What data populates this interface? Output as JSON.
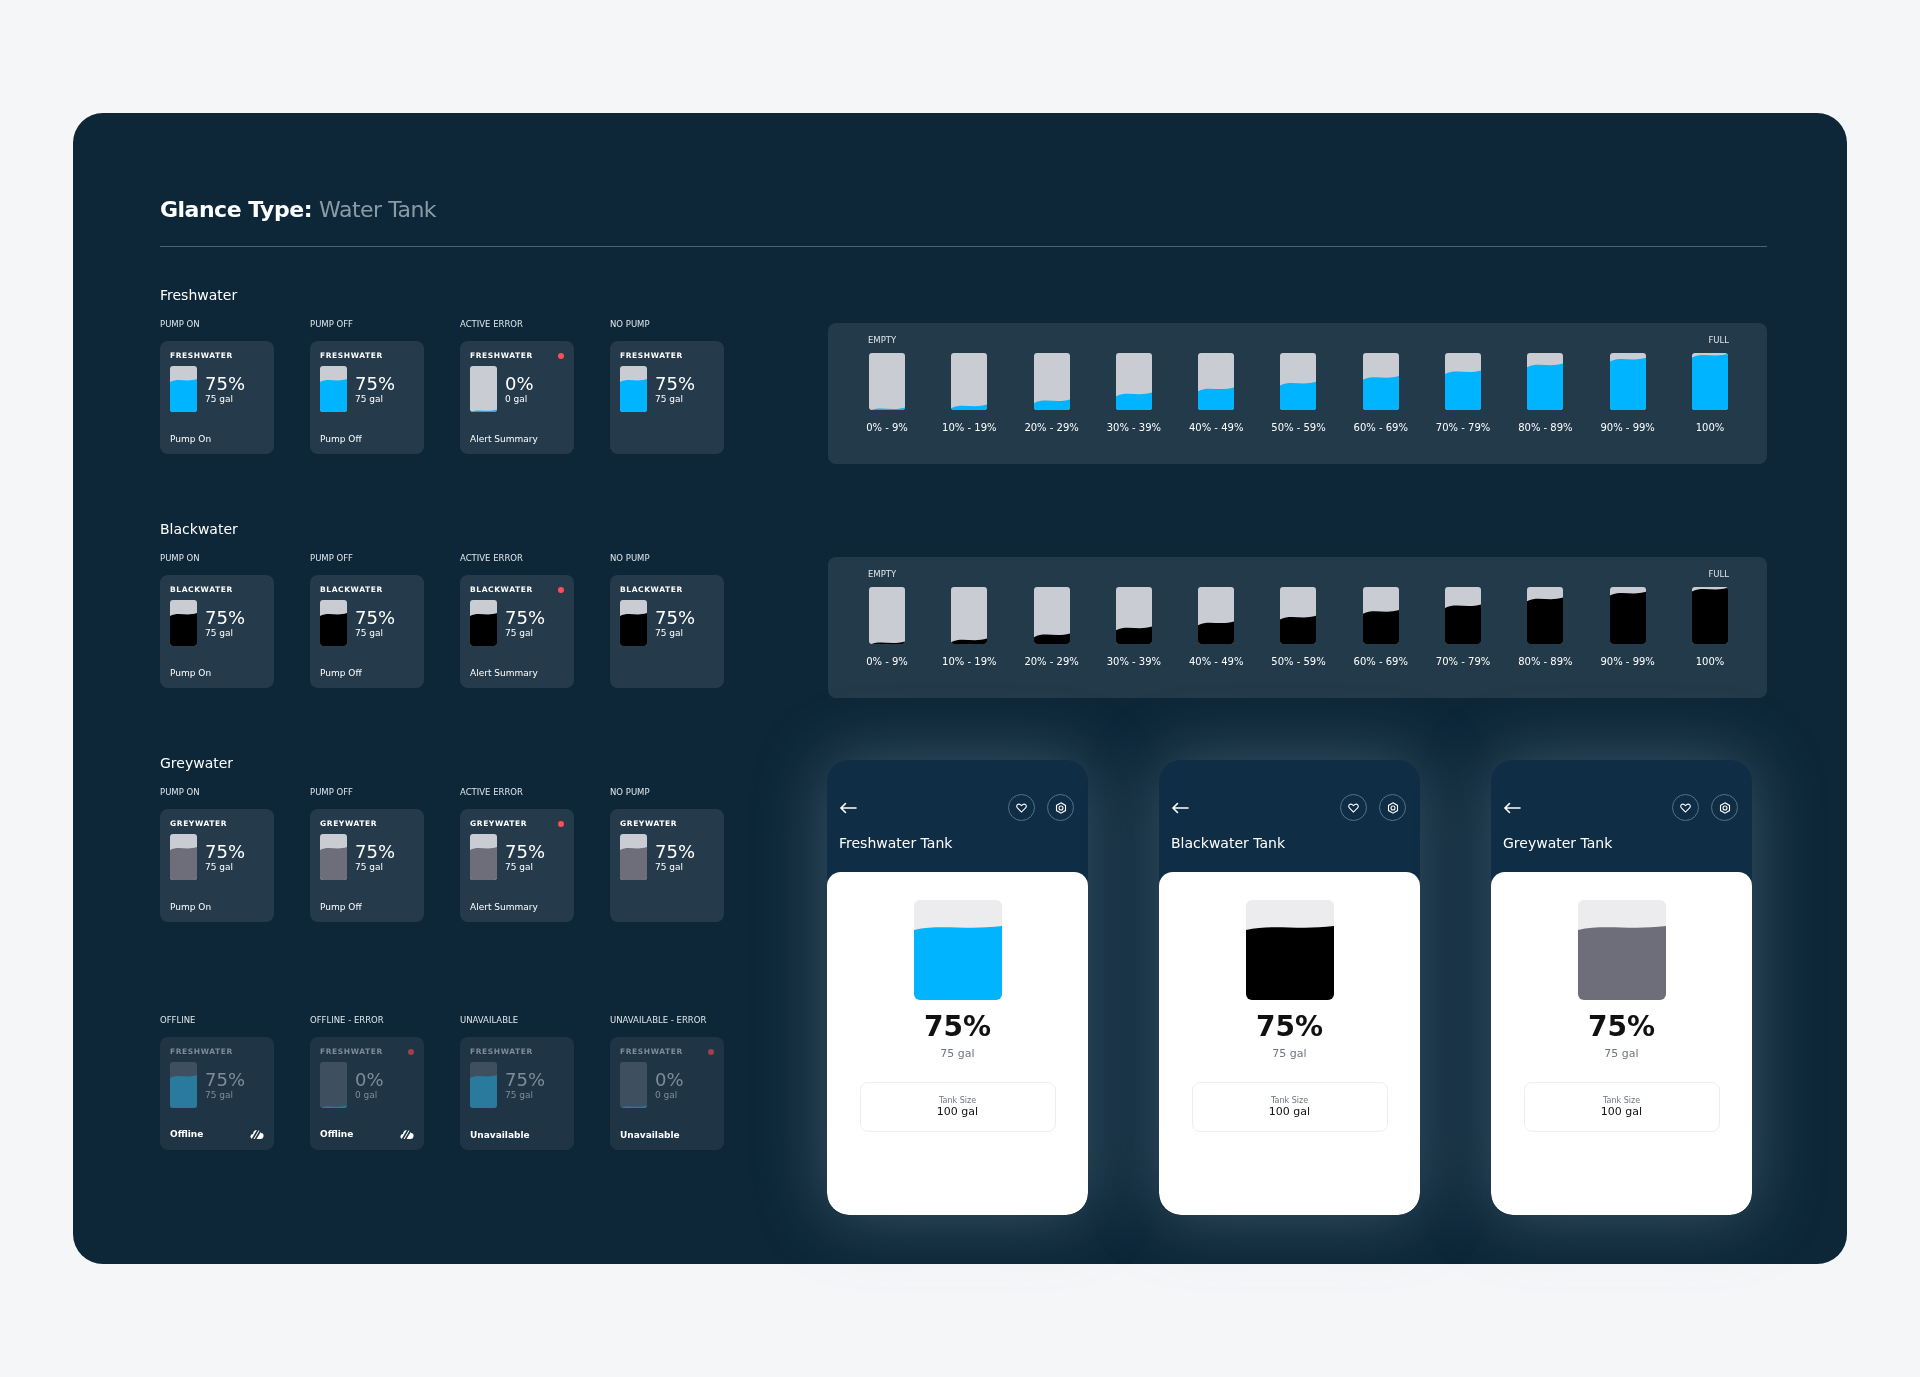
{
  "title": {
    "lead": "Glance Type:",
    "value": "Water Tank"
  },
  "sections": [
    {
      "name": "Freshwater",
      "scale": {
        "kind": "fresh",
        "empty_label": "EMPTY",
        "full_label": "FULL",
        "steps": [
          {
            "label": "0% - 9%",
            "level": 0.03
          },
          {
            "label": "10% - 19%",
            "level": 0.08
          },
          {
            "label": "20% - 29%",
            "level": 0.17
          },
          {
            "label": "30% - 39%",
            "level": 0.29
          },
          {
            "label": "40% - 49%",
            "level": 0.38
          },
          {
            "label": "50% - 59%",
            "level": 0.48
          },
          {
            "label": "60% - 69%",
            "level": 0.58
          },
          {
            "label": "70% - 79%",
            "level": 0.68
          },
          {
            "label": "80% - 89%",
            "level": 0.8
          },
          {
            "label": "90% - 99%",
            "level": 0.9
          },
          {
            "label": "100%",
            "level": 0.97
          }
        ]
      },
      "cards": [
        {
          "state": "PUMP ON",
          "tank": "FRESHWATER",
          "kind": "fresh",
          "percent": "75%",
          "gal": "75 gal",
          "level": 0.7,
          "footer": "Pump On",
          "alert": false,
          "dimmed": false
        },
        {
          "state": "PUMP OFF",
          "tank": "FRESHWATER",
          "kind": "fresh",
          "percent": "75%",
          "gal": "75 gal",
          "level": 0.7,
          "footer": "Pump Off",
          "alert": false,
          "dimmed": false
        },
        {
          "state": "ACTIVE ERROR",
          "tank": "FRESHWATER",
          "kind": "fresh",
          "percent": "0%",
          "gal": "0 gal",
          "level": 0.04,
          "footer": "Alert Summary",
          "alert": true,
          "dimmed": false
        },
        {
          "state": "NO PUMP",
          "tank": "FRESHWATER",
          "kind": "fresh",
          "percent": "75%",
          "gal": "75 gal",
          "level": 0.7,
          "alert": false,
          "dimmed": false
        }
      ]
    },
    {
      "name": "Blackwater",
      "scale": {
        "kind": "black",
        "empty_label": "EMPTY",
        "full_label": "FULL",
        "steps": [
          {
            "label": "0% - 9%",
            "level": 0.03
          },
          {
            "label": "10% - 19%",
            "level": 0.08
          },
          {
            "label": "20% - 29%",
            "level": 0.17
          },
          {
            "label": "30% - 39%",
            "level": 0.29
          },
          {
            "label": "40% - 49%",
            "level": 0.38
          },
          {
            "label": "50% - 59%",
            "level": 0.48
          },
          {
            "label": "60% - 69%",
            "level": 0.58
          },
          {
            "label": "70% - 79%",
            "level": 0.68
          },
          {
            "label": "80% - 89%",
            "level": 0.8
          },
          {
            "label": "90% - 99%",
            "level": 0.9
          },
          {
            "label": "100%",
            "level": 0.97
          }
        ]
      },
      "cards": [
        {
          "state": "PUMP ON",
          "tank": "BLACKWATER",
          "kind": "black",
          "percent": "75%",
          "gal": "75 gal",
          "level": 0.7,
          "footer": "Pump On",
          "alert": false,
          "dimmed": false
        },
        {
          "state": "PUMP OFF",
          "tank": "BLACKWATER",
          "kind": "black",
          "percent": "75%",
          "gal": "75 gal",
          "level": 0.7,
          "footer": "Pump Off",
          "alert": false,
          "dimmed": false
        },
        {
          "state": "ACTIVE ERROR",
          "tank": "BLACKWATER",
          "kind": "black",
          "percent": "75%",
          "gal": "75 gal",
          "level": 0.7,
          "footer": "Alert Summary",
          "alert": true,
          "dimmed": false
        },
        {
          "state": "NO PUMP",
          "tank": "BLACKWATER",
          "kind": "black",
          "percent": "75%",
          "gal": "75 gal",
          "level": 0.7,
          "alert": false,
          "dimmed": false
        }
      ]
    },
    {
      "name": "Greywater",
      "cards": [
        {
          "state": "PUMP ON",
          "tank": "GREYWATER",
          "kind": "grey",
          "percent": "75%",
          "gal": "75 gal",
          "level": 0.7,
          "footer": "Pump On",
          "alert": false,
          "dimmed": false
        },
        {
          "state": "PUMP OFF",
          "tank": "GREYWATER",
          "kind": "grey",
          "percent": "75%",
          "gal": "75 gal",
          "level": 0.7,
          "footer": "Pump Off",
          "alert": false,
          "dimmed": false
        },
        {
          "state": "ACTIVE ERROR",
          "tank": "GREYWATER",
          "kind": "grey",
          "percent": "75%",
          "gal": "75 gal",
          "level": 0.7,
          "footer": "Alert Summary",
          "alert": true,
          "dimmed": false
        },
        {
          "state": "NO PUMP",
          "tank": "GREYWATER",
          "kind": "grey",
          "percent": "75%",
          "gal": "75 gal",
          "level": 0.7,
          "alert": false,
          "dimmed": false
        }
      ]
    },
    {
      "cards": [
        {
          "state": "OFFLINE",
          "tank": "FRESHWATER",
          "kind": "fresh",
          "percent": "75%",
          "gal": "75 gal",
          "level": 0.7,
          "footer": "Offline",
          "alert": false,
          "dimmed": true,
          "offline_icon": true
        },
        {
          "state": "OFFLINE - ERROR",
          "tank": "FRESHWATER",
          "kind": "fresh",
          "percent": "0%",
          "gal": "0 gal",
          "level": 0.04,
          "footer": "Offline",
          "alert": true,
          "dimmed": true,
          "offline_icon": true
        },
        {
          "state": "UNAVAILABLE",
          "tank": "FRESHWATER",
          "kind": "fresh",
          "percent": "75%",
          "gal": "75 gal",
          "level": 0.7,
          "footer": "Unavailable",
          "alert": false,
          "dimmed": true,
          "offline_icon": false
        },
        {
          "state": "UNAVAILABLE - ERROR",
          "tank": "FRESHWATER",
          "kind": "fresh",
          "percent": "0%",
          "gal": "0 gal",
          "level": 0.04,
          "footer": "Unavailable",
          "alert": true,
          "dimmed": true,
          "offline_icon": false
        }
      ]
    }
  ],
  "phones": [
    {
      "title": "Freshwater Tank",
      "kind": "fresh",
      "level": 0.73,
      "percent": "75%",
      "gal": "75 gal",
      "size_label": "Tank Size",
      "size": "100 gal"
    },
    {
      "title": "Blackwater Tank",
      "kind": "black",
      "level": 0.73,
      "percent": "75%",
      "gal": "75 gal",
      "size_label": "Tank Size",
      "size": "100 gal"
    },
    {
      "title": "Greywater Tank",
      "kind": "grey",
      "level": 0.73,
      "percent": "75%",
      "gal": "75 gal",
      "size_label": "Tank Size",
      "size": "100 gal"
    }
  ]
}
